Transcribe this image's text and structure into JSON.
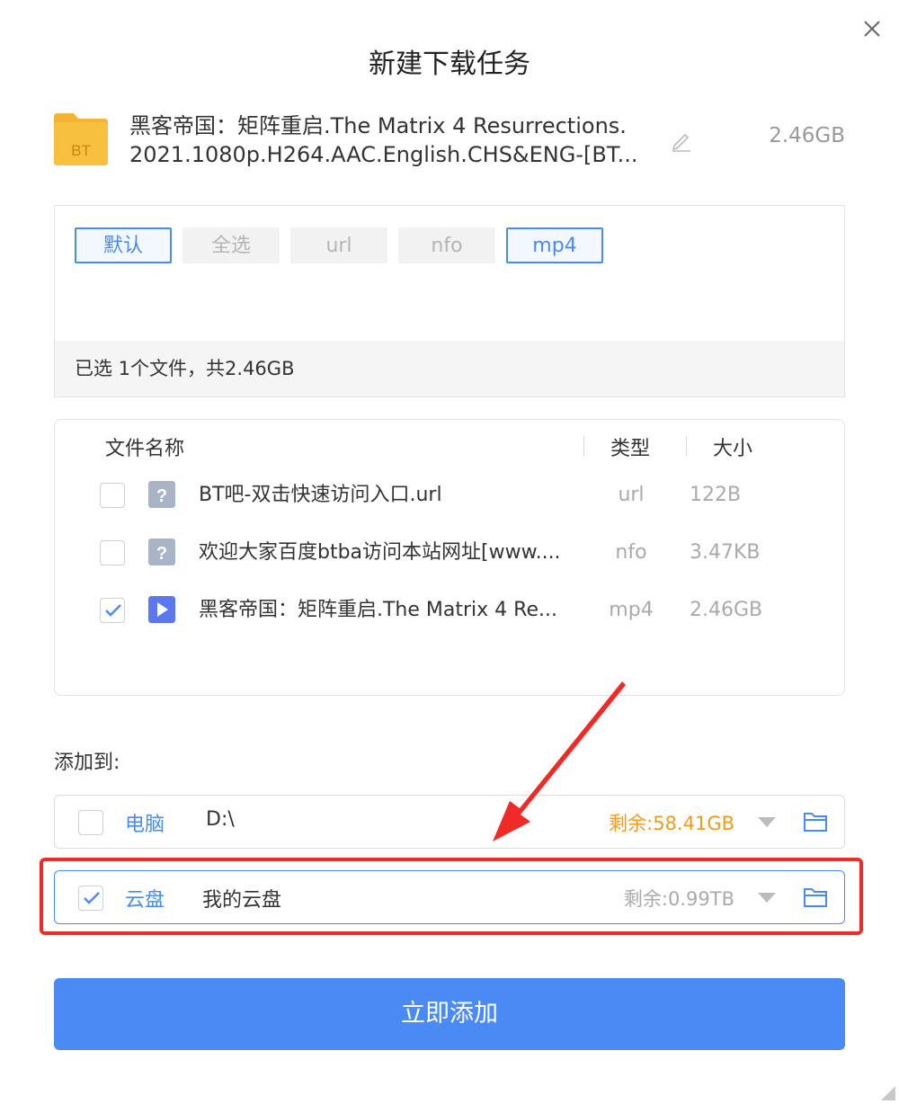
{
  "dialog": {
    "title": "新建下载任务"
  },
  "task": {
    "icon_label": "BT",
    "name_line1": "黑客帝国：矩阵重启.The Matrix 4 Resurrections.",
    "name_line2": "2021.1080p.H264.AAC.English.CHS&ENG-[BT...",
    "size": "2.46GB"
  },
  "filters": {
    "tags": [
      {
        "label": "默认",
        "active": true
      },
      {
        "label": "全选",
        "active": false
      },
      {
        "label": "url",
        "active": false
      },
      {
        "label": "nfo",
        "active": false
      },
      {
        "label": "mp4",
        "active": true
      }
    ],
    "summary": "已选 1个文件，共2.46GB"
  },
  "file_list": {
    "headers": {
      "name": "文件名称",
      "type": "类型",
      "size": "大小"
    },
    "rows": [
      {
        "name": "BT吧-双击快速访问入口.url",
        "type": "url",
        "size": "122B",
        "checked": false,
        "icon": "unknown-file-icon"
      },
      {
        "name": "欢迎大家百度btba访问本站网址[www....",
        "type": "nfo",
        "size": "3.47KB",
        "checked": false,
        "icon": "unknown-file-icon"
      },
      {
        "name": "黑客帝国：矩阵重启.The Matrix 4 Re...",
        "type": "mp4",
        "size": "2.46GB",
        "checked": true,
        "icon": "video-file-icon"
      }
    ]
  },
  "add_to": {
    "label": "添加到:",
    "destinations": [
      {
        "name": "电脑",
        "path": "D:\\",
        "free": "剩余:58.41GB",
        "checked": false,
        "free_color": "#f29a1a"
      },
      {
        "name": "云盘",
        "path": "我的云盘",
        "free": "剩余:0.99TB",
        "checked": true,
        "free_color": "#aaaaaa"
      }
    ]
  },
  "submit": {
    "label": "立即添加"
  },
  "colors": {
    "accent": "#4a8af4",
    "highlight": "#f02a26",
    "warning": "#f29a1a"
  }
}
